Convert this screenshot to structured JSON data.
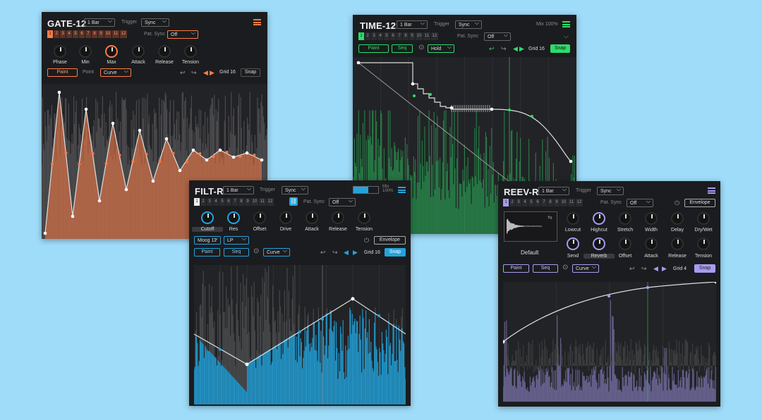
{
  "colors": {
    "background": "#9fdcf9",
    "gate": "#ff7b45",
    "time": "#2ddc6a",
    "filt": "#23a3dc",
    "reev": "#a79cf0"
  },
  "gate": {
    "title": "GATE-12",
    "length": "1 Bar",
    "trigger_label": "Trigger",
    "trigger": "Sync",
    "steps": [
      "1",
      "2",
      "3",
      "4",
      "5",
      "6",
      "7",
      "8",
      "9",
      "10",
      "11",
      "12"
    ],
    "pat_sync_label": "Pat. Sync",
    "pat_sync": "Off",
    "knobs": [
      "Phase",
      "Min",
      "Max",
      "Attack",
      "Release",
      "Tension"
    ],
    "paint": "Paint",
    "point_label": "Point",
    "point_mode": "Curve",
    "grid": "Grid 16",
    "snap": "Snap"
  },
  "time": {
    "title": "TIME-12",
    "length": "1 Bar",
    "trigger_label": "Trigger",
    "trigger": "Sync",
    "mix": "Mix 100%",
    "steps": [
      "1",
      "2",
      "3",
      "4",
      "5",
      "6",
      "7",
      "8",
      "9",
      "10",
      "11",
      "12"
    ],
    "pat_sync_label": "Pat. Sync",
    "pat_sync": "Off",
    "paint": "Paint",
    "seq": "Seq",
    "mode": "Hold",
    "grid": "Grid 16",
    "snap": "Snap"
  },
  "filt": {
    "title": "FILT-R",
    "length": "1 Bar",
    "trigger_label": "Trigger",
    "trigger": "Sync",
    "mix": "Mix\n100%",
    "steps": [
      "1",
      "2",
      "3",
      "4",
      "5",
      "6",
      "7",
      "8",
      "9",
      "10",
      "11",
      "12"
    ],
    "pat_sync_label": "Pat. Sync",
    "pat_sync": "Off",
    "knobs": [
      "Cutoff",
      "Res",
      "Offset",
      "Drive",
      "Attack",
      "Release",
      "Tension"
    ],
    "filter_model": "Moog 12",
    "filter_type": "LP",
    "envelope": "Envelope",
    "paint": "Paint",
    "seq": "Seq",
    "mode": "Curve",
    "grid": "Grid 16",
    "snap": "Snap"
  },
  "reev": {
    "title": "REEV-R",
    "length": "1 Bar",
    "trigger_label": "Trigger",
    "trigger": "Sync",
    "steps": [
      "1",
      "2",
      "3",
      "4",
      "5",
      "6",
      "7",
      "8",
      "9",
      "10",
      "11",
      "12"
    ],
    "pat_sync_label": "Pat. Sync",
    "pat_sync": "Off",
    "envelope": "Envelope",
    "ir_name": "Default",
    "knobs_row1": [
      "Lowcut",
      "Highcut",
      "Stretch",
      "Width",
      "Delay",
      "Dry/Wet"
    ],
    "knobs_row2": [
      "Send",
      "Reverb",
      "Offset",
      "Attack",
      "Release",
      "Tension"
    ],
    "paint": "Paint",
    "seq": "Seq",
    "mode": "Curve",
    "grid": "Grid 4",
    "snap": "Snap"
  }
}
